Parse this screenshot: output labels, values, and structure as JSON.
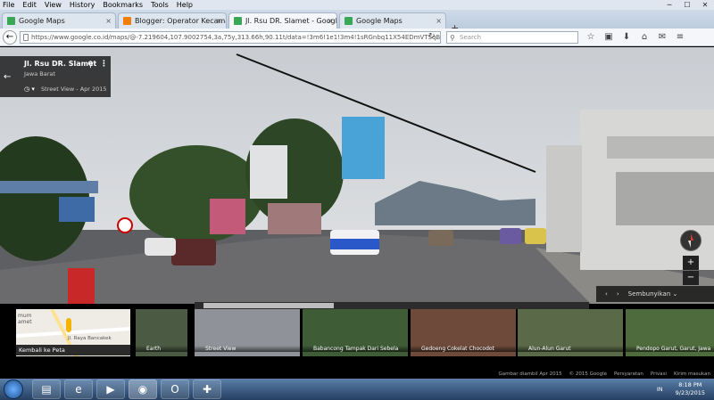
{
  "menu": [
    "File",
    "Edit",
    "View",
    "History",
    "Bookmarks",
    "Tools",
    "Help"
  ],
  "window_controls": [
    "─",
    "☐",
    "✕"
  ],
  "tabs": [
    {
      "label": "Google Maps",
      "favicon_color": "#3aa757"
    },
    {
      "label": "Blogger: Operator Kecamat...",
      "favicon_color": "#f57d00"
    },
    {
      "label": "Jl. Rsu DR. Slamet - Google...",
      "favicon_color": "#3aa757"
    },
    {
      "label": "Google Maps",
      "favicon_color": "#3aa757"
    }
  ],
  "tab_close": "×",
  "new_tab": "+",
  "url": "https://www.google.co.id/maps/@-7.219604,107.9002754,3a,75y,313.66h,90.11t/data=!3m6!1e1!3m4!1sRGnbq11X54EDmVTSqBJweQ!2e0!7i13",
  "search_placeholder": "Search",
  "nav_icons": [
    "☆",
    "▣",
    "⬇",
    "⌂",
    "✉",
    "≡"
  ],
  "panel": {
    "title": "Jl. Rsu DR. Slamet",
    "region": "Jawa Barat",
    "date": "Street View - Apr 2015",
    "back": "←",
    "pin": "⚲",
    "more": "⋮",
    "clock": "◷ ▾"
  },
  "controls": {
    "zoom_in": "+",
    "zoom_out": "−",
    "prev": "‹",
    "next": "›",
    "hide": "Sembunyikan ⌄"
  },
  "thumbnails": [
    {
      "caption": "Earth"
    },
    {
      "caption": "Street View"
    },
    {
      "caption": "Babancong Tampak Dari Sebela"
    },
    {
      "caption": "Gedoeng Cokelat Chocodot"
    },
    {
      "caption": "Alun-Alun Garut"
    },
    {
      "caption": "Pendopo Garut, Garut, Jawa"
    }
  ],
  "map_thumb_label": "Kembali ke Peta",
  "map_text": [
    "mum",
    "amet",
    "Jl. Raya Bancakek"
  ],
  "footer": [
    "Gambar diambil Apr 2015",
    "© 2015 Google",
    "Persyaratan",
    "Privasi",
    "Kirim masukan"
  ],
  "tray": {
    "lang": "IN",
    "time": "8:18 PM",
    "date": "9/23/2015"
  },
  "taskbar_icons": [
    "▤",
    "e",
    "▶",
    "◉",
    "O",
    "✚"
  ]
}
